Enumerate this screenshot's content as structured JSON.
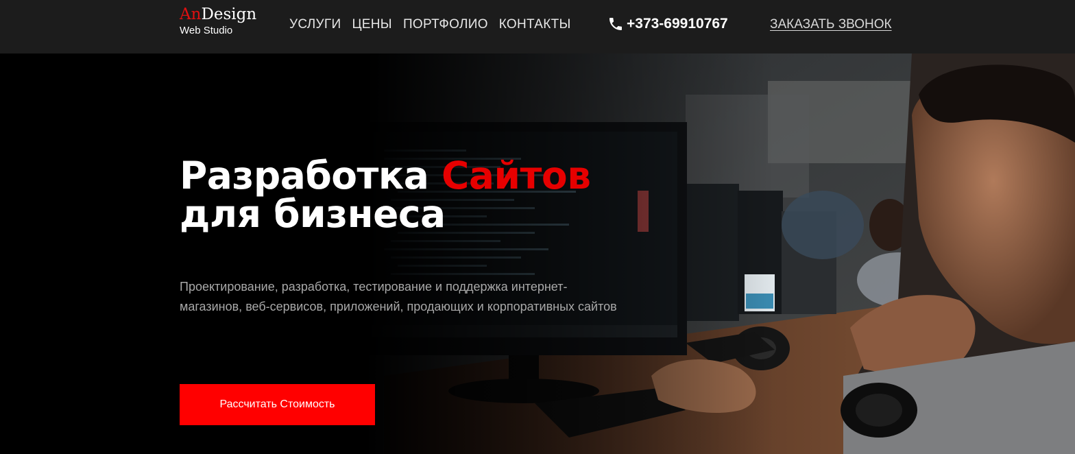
{
  "header": {
    "logo": {
      "accent": "An",
      "name_rest": "Design",
      "subtitle": "Web Studio"
    },
    "nav": [
      {
        "label": "УСЛУГИ"
      },
      {
        "label": "ЦЕНЫ"
      },
      {
        "label": "ПОРТФОЛИО"
      },
      {
        "label": "КОНТАКТЫ"
      }
    ],
    "phone": {
      "icon": "phone-icon",
      "number": "+373-69910767"
    },
    "callback_label": "ЗАКАЗАТЬ ЗВОНОК"
  },
  "hero": {
    "title_part1": "Разработка ",
    "title_accent": "Сайтов",
    "title_line2": "для бизнеса",
    "description": "Проектирование, разработка, тестирование и поддержка интернет-магазинов, веб-сервисов, приложений, продающих и корпоративных сайтов",
    "cta_label": "Рассчитать Стоимость"
  },
  "colors": {
    "accent": "#ff0000",
    "header_bg": "#1c1c1c",
    "hero_bg": "#000000"
  }
}
